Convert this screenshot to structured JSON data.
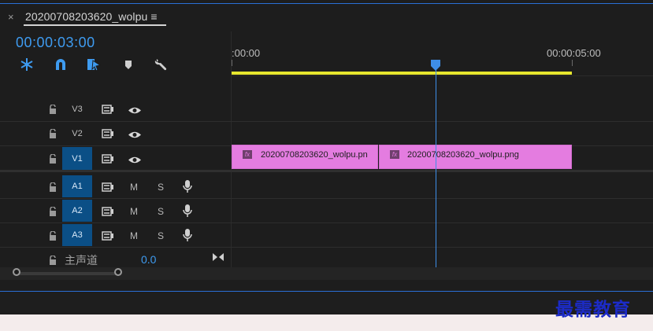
{
  "header": {
    "close_glyph": "×",
    "tab_title": "20200708203620_wolpu ≡"
  },
  "timecode": "00:00:03:00",
  "toolbar": {
    "icons": [
      "snap-insert-icon",
      "magnet-icon",
      "linked-selection-icon",
      "marker-icon",
      "wrench-icon"
    ]
  },
  "ruler": {
    "labels": [
      ":00:00",
      "00:00:05:00"
    ],
    "work_area_color": "#e6e62e",
    "playhead_color": "#3e8ee8"
  },
  "tracks": [
    {
      "name": "V3",
      "type": "video",
      "targeted": false
    },
    {
      "name": "V2",
      "type": "video",
      "targeted": false
    },
    {
      "name": "V1",
      "type": "video",
      "targeted": true
    },
    {
      "name": "A1",
      "type": "audio",
      "targeted": true,
      "m": "M",
      "s": "S"
    },
    {
      "name": "A2",
      "type": "audio",
      "targeted": true,
      "m": "M",
      "s": "S"
    },
    {
      "name": "A3",
      "type": "audio",
      "targeted": true,
      "m": "M",
      "s": "S"
    }
  ],
  "master": {
    "label": "主声道",
    "value": "0.0"
  },
  "clips": [
    {
      "fx": "fx",
      "label": "20200708203620_wolpu.pn"
    },
    {
      "fx": "fx",
      "label": "20200708203620_wolpu.png"
    }
  ],
  "clip_color": "#e47ce0",
  "accent_color": "#3e9bf0",
  "watermark": "最需教育"
}
